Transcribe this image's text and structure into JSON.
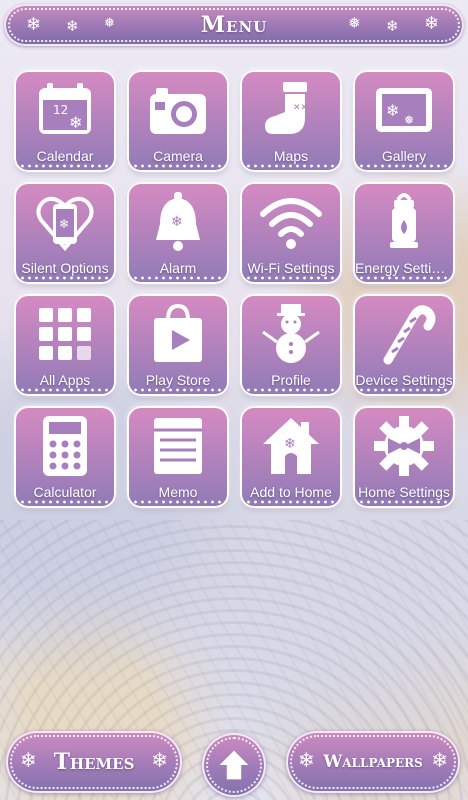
{
  "header": {
    "title": "Menu"
  },
  "apps": [
    {
      "label": "Calendar",
      "icon": "calendar-icon",
      "day": "12"
    },
    {
      "label": "Camera",
      "icon": "camera-icon"
    },
    {
      "label": "Maps",
      "icon": "stocking-icon"
    },
    {
      "label": "Gallery",
      "icon": "picture-frame-icon"
    },
    {
      "label": "Silent Options",
      "icon": "phone-heart-icon"
    },
    {
      "label": "Alarm",
      "icon": "bell-icon"
    },
    {
      "label": "Wi-Fi Settings",
      "icon": "wifi-icon"
    },
    {
      "label": "Energy Settings",
      "icon": "lantern-icon"
    },
    {
      "label": "All Apps",
      "icon": "app-grid-icon"
    },
    {
      "label": "Play Store",
      "icon": "shopping-bag-play-icon"
    },
    {
      "label": "Profile",
      "icon": "snowman-icon"
    },
    {
      "label": "Device Settings",
      "icon": "candy-cane-icon"
    },
    {
      "label": "Calculator",
      "icon": "calculator-icon"
    },
    {
      "label": "Memo",
      "icon": "notepad-icon"
    },
    {
      "label": "Add to Home",
      "icon": "house-icon"
    },
    {
      "label": "Home Settings",
      "icon": "gear-bow-icon"
    }
  ],
  "bottom": {
    "themes_label": "Themes",
    "wallpapers_label": "Wallpapers",
    "home_icon": "home-arrow-icon"
  }
}
